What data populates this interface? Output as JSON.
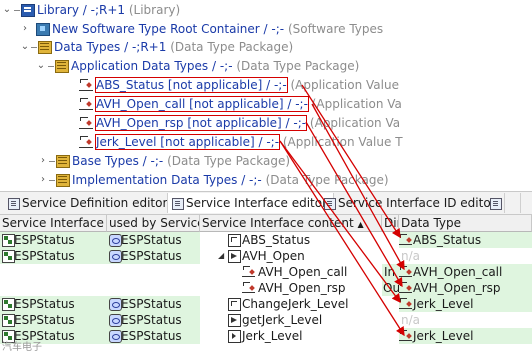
{
  "tree": {
    "library": {
      "name": "Library / -;R+1",
      "kind": "(Library)"
    },
    "nsrc": {
      "name": "New Software Type Root Container / -;-",
      "kind": "(Software Types"
    },
    "data_types": {
      "name": "Data Types / -;R+1",
      "kind": "(Data Type Package)"
    },
    "app_types": {
      "name": "Application Data Types / -;-",
      "kind": "(Data Type Package)"
    },
    "items": [
      {
        "name": "ABS_Status [not applicable] / -;-",
        "kind": "(Application Value"
      },
      {
        "name": "AVH_Open_call [not applicable] / -;-",
        "kind": "(Application Va"
      },
      {
        "name": "AVH_Open_rsp [not applicable] / -;-",
        "kind": "(Application Va"
      },
      {
        "name": "Jerk_Level [not applicable] / -;-",
        "kind": "(Application Value T"
      }
    ],
    "base_types": {
      "name": "Base Types / -;-",
      "kind": "(Data Type Package)"
    },
    "impl_types": {
      "name": "Implementation Data Types / -;-",
      "kind": "(Data Type Package)"
    }
  },
  "tabs": [
    {
      "label": "Service Definition editor"
    },
    {
      "label": "Service Interface editor"
    },
    {
      "label": "Service Interface ID editor"
    }
  ],
  "table": {
    "headers": [
      "Service Interface",
      "used by Service",
      "Service Interface content",
      "Dir",
      "Data Type"
    ],
    "sort_indicator": "▲",
    "rows": [
      {
        "si": "ESPStatus",
        "svc": "ESPStatus",
        "content": "ABS_Status",
        "dir": "",
        "dt": "ABS_Status"
      },
      {
        "si": "ESPStatus",
        "svc": "ESPStatus",
        "content": "AVH_Open",
        "dir": "",
        "dt": "n/a"
      },
      {
        "si": "",
        "svc": "",
        "content": "AVH_Open_call",
        "dir": "In",
        "dt": "AVH_Open_call"
      },
      {
        "si": "",
        "svc": "",
        "content": "AVH_Open_rsp",
        "dir": "Out",
        "dt": "AVH_Open_rsp"
      },
      {
        "si": "ESPStatus",
        "svc": "ESPStatus",
        "content": "ChangeJerk_Level",
        "dir": "",
        "dt": "Jerk_Level"
      },
      {
        "si": "ESPStatus",
        "svc": "ESPStatus",
        "content": "getJerk_Level",
        "dir": "",
        "dt": "n/a"
      },
      {
        "si": "ESPStatus",
        "svc": "ESPStatus",
        "content": "Jerk_Level",
        "dir": "",
        "dt": "Jerk_Level"
      }
    ]
  },
  "watermark": "汽车电子",
  "colors": {
    "highlight": "#d40000",
    "row_green": "#dff5df",
    "link_blue": "#1a3aa8"
  }
}
